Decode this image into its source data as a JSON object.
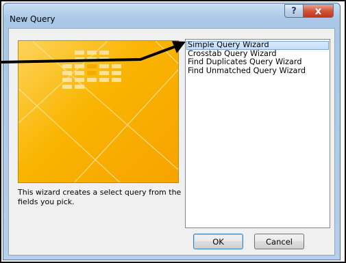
{
  "window": {
    "title": "New Query",
    "help_button_label": "?",
    "close_button_label": "x"
  },
  "preview": {
    "description": "This wizard creates a select query from the fields you pick."
  },
  "wizard_list": {
    "items": [
      {
        "label": "Simple Query Wizard",
        "selected": true
      },
      {
        "label": "Crosstab Query Wizard",
        "selected": false
      },
      {
        "label": "Find Duplicates Query Wizard",
        "selected": false
      },
      {
        "label": "Find Unmatched Query Wizard",
        "selected": false
      }
    ]
  },
  "buttons": {
    "ok_label": "OK",
    "cancel_label": "Cancel"
  },
  "colors": {
    "preview_orange": "#f9b400",
    "selection_blue": "#c4dcf6",
    "annotation_arrow": "#000000"
  }
}
